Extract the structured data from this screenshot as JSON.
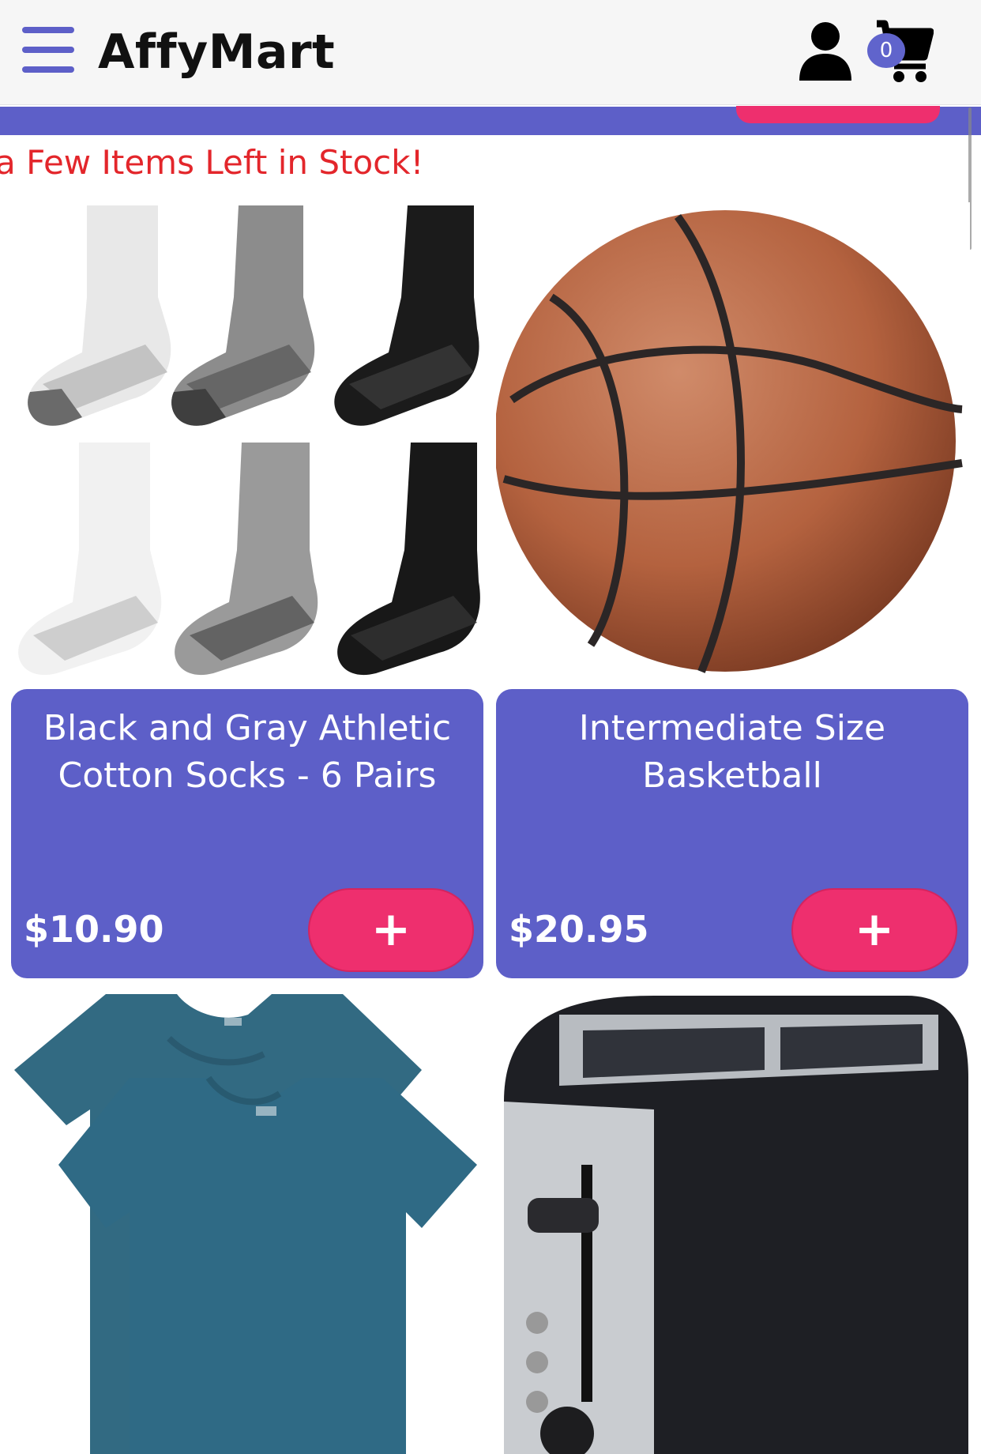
{
  "app": {
    "name": "AffyMart",
    "accent_color": "#5d5fc8",
    "button_color": "#ee2f6e",
    "notice_color": "#e3262b"
  },
  "header": {
    "menu_icon": "hamburger-menu-icon",
    "user_icon": "user-icon",
    "cart_icon": "shopping-cart-icon",
    "cart_count": "0"
  },
  "notice": {
    "text": "a Few Items Left in Stock!"
  },
  "products": [
    {
      "title_line1": "Black and Gray Athletic",
      "title_line2": "Cotton Socks - 6 Pairs",
      "price": "$10.90",
      "add_label": "+"
    },
    {
      "title_line1": "Intermediate Size",
      "title_line2": "Basketball",
      "price": "$20.95",
      "add_label": "+"
    },
    {
      "image": "teal t-shirts"
    },
    {
      "image": "toaster"
    }
  ]
}
